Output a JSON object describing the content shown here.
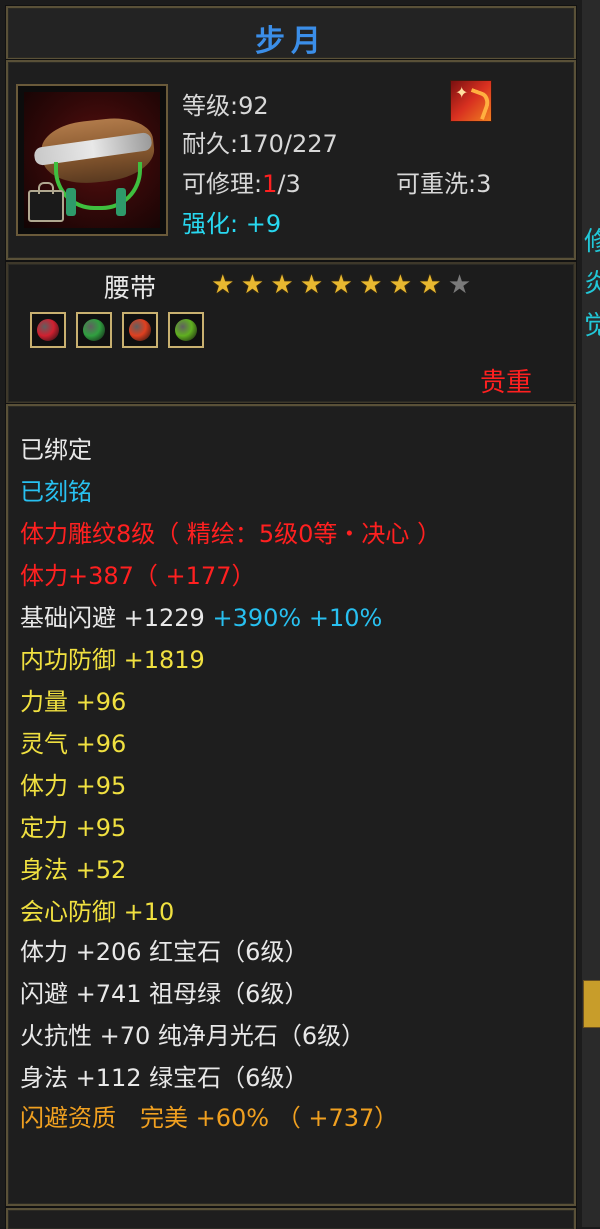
{
  "item": {
    "name": "步月",
    "level_text": "等级:92",
    "durability_text": "耐久:170/227",
    "repair_label": "可修理:",
    "repair_used": "1",
    "repair_total": "/3",
    "reroll_text": "可重洗:3",
    "enhance_label": "强化:",
    "enhance_value": "+9",
    "type": "腰带",
    "stars_filled": 8,
    "stars_total": 9,
    "rarity": "贵重"
  },
  "gems": [
    {
      "icon": "red-gem-icon",
      "color": "#d02030"
    },
    {
      "icon": "green-gem-icon",
      "color": "#30a040"
    },
    {
      "icon": "fire-gem-icon",
      "color": "#e04020"
    },
    {
      "icon": "moon-gem-icon",
      "color": "#60b020"
    }
  ],
  "stats": {
    "bound": "已绑定",
    "engraved": "已刻铭",
    "carving": "体力雕纹8级（ 精绘：5级0等・决心 ）",
    "stamina_main": "体力+387（ +177）",
    "dodge_base": "基础闪避 +1229",
    "dodge_pct": "+390%",
    "dodge_bonus": "+10%",
    "inner_def": "内功防御 +1819",
    "strength": "力量 +96",
    "spirit": "灵气 +96",
    "stamina": "体力 +95",
    "focus": "定力 +95",
    "agility": "身法 +52",
    "crit_def": "会心防御 +10",
    "gem_stamina": "体力 +206 红宝石（6级）",
    "gem_dodge": "闪避 +741 祖母绿（6级）",
    "gem_fire": "火抗性 +70 纯净月光石（6级）",
    "gem_agility": "身法 +112 绿宝石（6级）",
    "quality": "闪避资质　完美 +60% （ +737）"
  },
  "colors": {
    "title": "#3b8ee8",
    "red": "#ff2020",
    "cyan": "#28c0f0",
    "yellow": "#f0e040",
    "orange": "#f0a020"
  }
}
